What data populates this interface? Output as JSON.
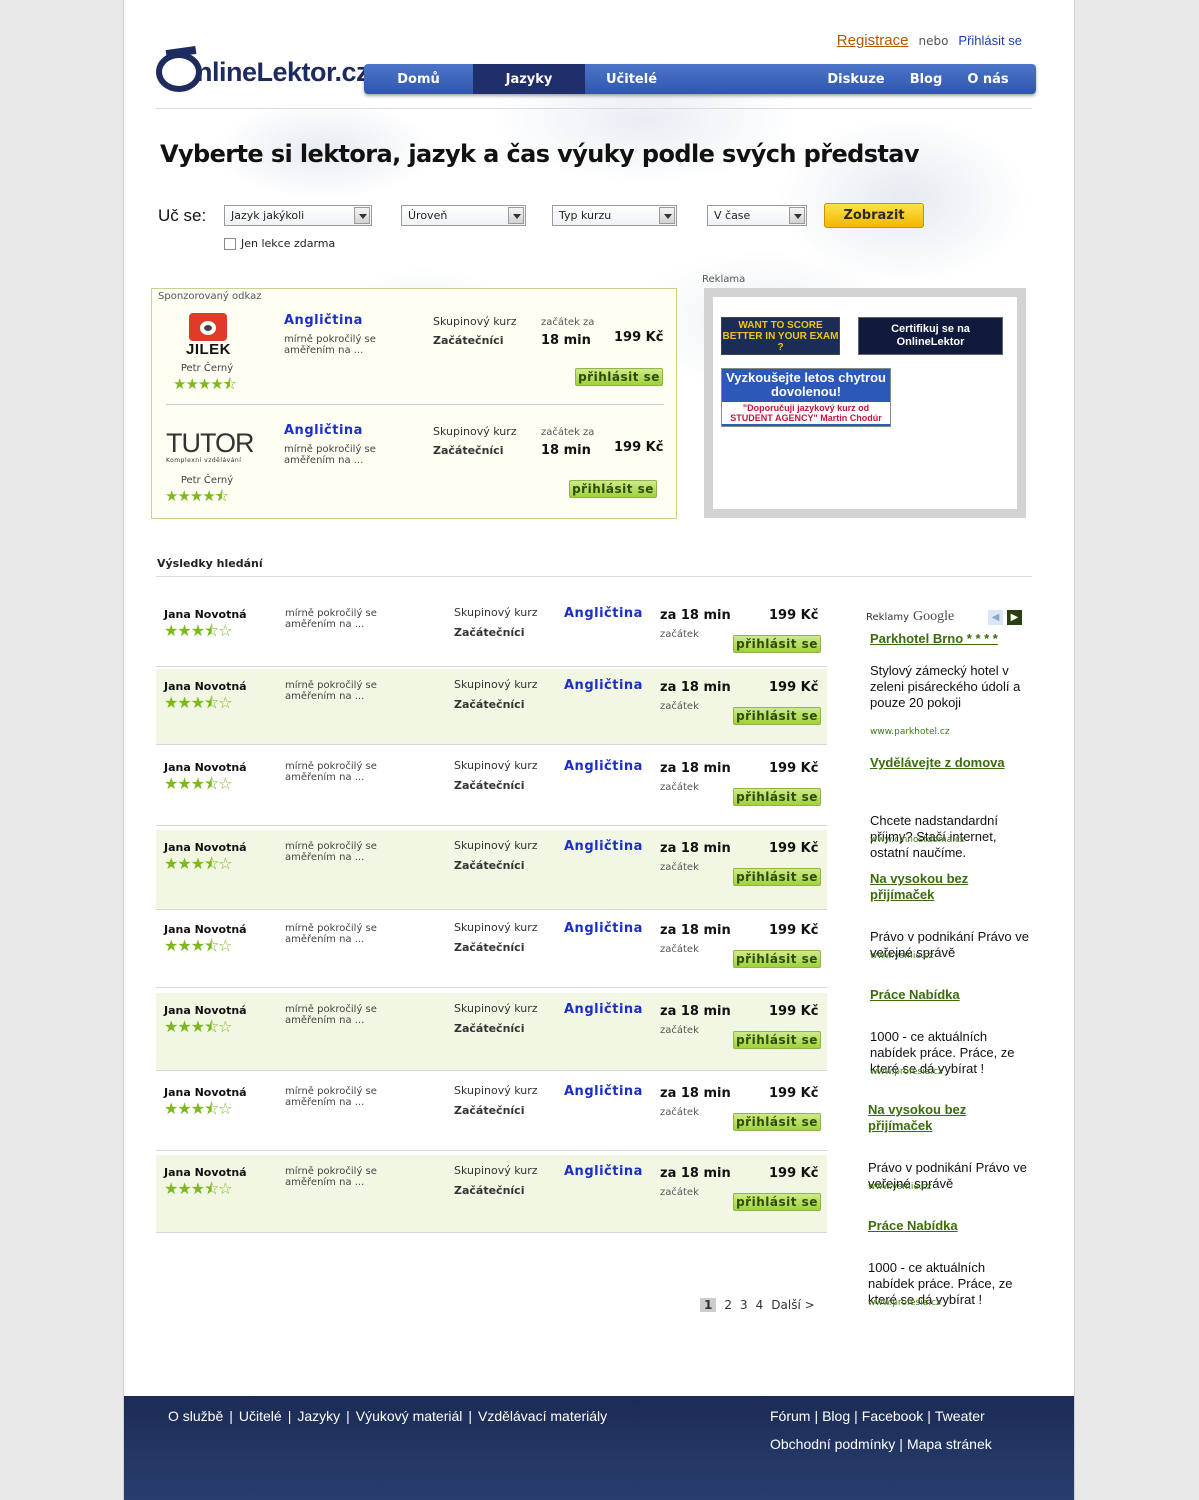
{
  "header": {
    "logo_text": "nlineLektor.cz",
    "register": "Registrace",
    "or": "nebo",
    "login": "Přihlásit se",
    "nav": [
      "Domů",
      "Jazyky",
      "Učitelé",
      "Diskuze",
      "Blog",
      "O nás"
    ]
  },
  "headline": "Vyberte si lektora, jazyk a čas výuky podle svých představ",
  "search": {
    "label": "Uč se:",
    "language": "Jazyk jakýkoli",
    "level": "Úroveň",
    "course_type": "Typ kurzu",
    "time": "V čase",
    "submit": "Zobrazit",
    "free_only": "Jen lekce zdarma"
  },
  "sponsored": {
    "title": "Sponzorovaný odkaz",
    "items": [
      {
        "logo": "JILEK",
        "teacher": "Petr Černý",
        "language": "Angličtina",
        "level": "mírně pokročilý se aměřením na ...",
        "type": "Skupinový kurz",
        "audience": "Začátečníci",
        "start_label": "začátek za",
        "start": "18 min",
        "price": "199 Kč",
        "button": "přihlásit se",
        "stars": "★★★★⯪"
      },
      {
        "logo": "TUTOR",
        "logo_sub": "Komplexní vzdělávání",
        "teacher": "Petr Černý",
        "language": "Angličtina",
        "level": "mírně pokročilý se aměřením na ...",
        "type": "Skupinový kurz",
        "audience": "Začátečníci",
        "start_label": "začátek za",
        "start": "18 min",
        "price": "199 Kč",
        "button": "přihlásit se",
        "stars": "★★★★⯪"
      }
    ]
  },
  "ads": {
    "label": "Reklama",
    "banner1": "WANT TO SCORE BETTER IN YOUR EXAM ?",
    "banner2": "Certifikuj se na OnlineLektor",
    "banner3_head": "Vyzkoušejte letos chytrou dovolenou!",
    "banner3_quote": "\"Doporučuji jazykový kurz od STUDENT AGENCY\" Martin Chodúr"
  },
  "results": {
    "title": "Výsledky hledání",
    "rows": [
      {
        "name": "Jana Novotná",
        "stars": "★★★⯪☆",
        "level": "mírně pokročilý se aměřením na ...",
        "type": "Skupinový kurz",
        "audience": "Začátečníci",
        "language": "Angličtina",
        "start": "za 18 min",
        "start_label": "začátek",
        "price": "199 Kč",
        "button": "přihlásit se"
      },
      {
        "name": "Jana Novotná",
        "stars": "★★★⯪☆",
        "level": "mírně pokročilý se aměřením na ...",
        "type": "Skupinový kurz",
        "audience": "Začátečníci",
        "language": "Angličtina",
        "start": "za 18 min",
        "start_label": "začátek",
        "price": "199 Kč",
        "button": "přihlásit se"
      },
      {
        "name": "Jana Novotná",
        "stars": "★★★⯪☆",
        "level": "mírně pokročilý se aměřením na ...",
        "type": "Skupinový kurz",
        "audience": "Začátečníci",
        "language": "Angličtina",
        "start": "za 18 min",
        "start_label": "začátek",
        "price": "199 Kč",
        "button": "přihlásit se"
      },
      {
        "name": "Jana Novotná",
        "stars": "★★★⯪☆",
        "level": "mírně pokročilý se aměřením na ...",
        "type": "Skupinový kurz",
        "audience": "Začátečníci",
        "language": "Angličtina",
        "start": "za 18 min",
        "start_label": "začátek",
        "price": "199 Kč",
        "button": "přihlásit se"
      },
      {
        "name": "Jana Novotná",
        "stars": "★★★⯪☆",
        "level": "mírně pokročilý se aměřením na ...",
        "type": "Skupinový kurz",
        "audience": "Začátečníci",
        "language": "Angličtina",
        "start": "za 18 min",
        "start_label": "začátek",
        "price": "199 Kč",
        "button": "přihlásit se"
      },
      {
        "name": "Jana Novotná",
        "stars": "★★★⯪☆",
        "level": "mírně pokročilý se aměřením na ...",
        "type": "Skupinový kurz",
        "audience": "Začátečníci",
        "language": "Angličtina",
        "start": "za 18 min",
        "start_label": "začátek",
        "price": "199 Kč",
        "button": "přihlásit se"
      },
      {
        "name": "Jana Novotná",
        "stars": "★★★⯪☆",
        "level": "mírně pokročilý se aměřením na ...",
        "type": "Skupinový kurz",
        "audience": "Začátečníci",
        "language": "Angličtina",
        "start": "za 18 min",
        "start_label": "začátek",
        "price": "199 Kč",
        "button": "přihlásit se"
      },
      {
        "name": "Jana Novotná",
        "stars": "★★★⯪☆",
        "level": "mírně pokročilý se aměřením na ...",
        "type": "Skupinový kurz",
        "audience": "Začátečníci",
        "language": "Angličtina",
        "start": "za 18 min",
        "start_label": "začátek",
        "price": "199 Kč",
        "button": "přihlásit se"
      }
    ]
  },
  "google_ads": {
    "header": "Reklamy",
    "brand": "Google",
    "items": [
      {
        "title": "Parkhotel Brno * * * *",
        "text": "Stylový zámecký hotel v zeleni pisáreckého údolí a pouze 20 pokoji",
        "url": "www.parkhotel.cz"
      },
      {
        "title": "Vydělávejte z domova",
        "text": "Chcete nadstandardní příjmy? Stačí internet, ostatní naučíme.",
        "url": "www.cinnostdoma.cz"
      },
      {
        "title": "Na vysokou bez přijímaček",
        "text": "Právo v podnikání Právo ve veřejné správě",
        "url": "www.vsmie.cz"
      },
      {
        "title": "Práce Nabídka",
        "text": "1000 - ce aktuálních nabídek práce. Práce, ze které se dá vybírat !",
        "url": "www.profesia.cz"
      },
      {
        "title": "Na vysokou bez přijímaček",
        "text": "Právo v podnikání Právo ve veřejné správě",
        "url": "www.vsmie.cz"
      },
      {
        "title": "Práce Nabídka",
        "text": "1000 - ce aktuálních nabídek práce. Práce, ze které se dá vybírat !",
        "url": "www.profesia.cz"
      }
    ]
  },
  "pagination": {
    "pages": [
      "1",
      "2",
      "3",
      "4"
    ],
    "current": "1",
    "next": "Další >"
  },
  "footer": {
    "left": [
      "O službě",
      "|",
      "Učitelé",
      "|",
      "Jazyky",
      "|",
      "Výukový materiál",
      "|",
      "Vzdělávací materiály"
    ],
    "right1": [
      "Fórum",
      "|",
      "Blog",
      "|",
      "Facebook",
      "|",
      "Tweater"
    ],
    "right2": [
      "Obchodní podmínky",
      "|",
      "Mapa stránek"
    ]
  },
  "colors": {
    "nav": "#2f57ad",
    "nav_active": "#1f2f6b",
    "accent_green": "#9ed23a",
    "link_blue": "#1c2fc4",
    "footer": "#1b2b55"
  }
}
